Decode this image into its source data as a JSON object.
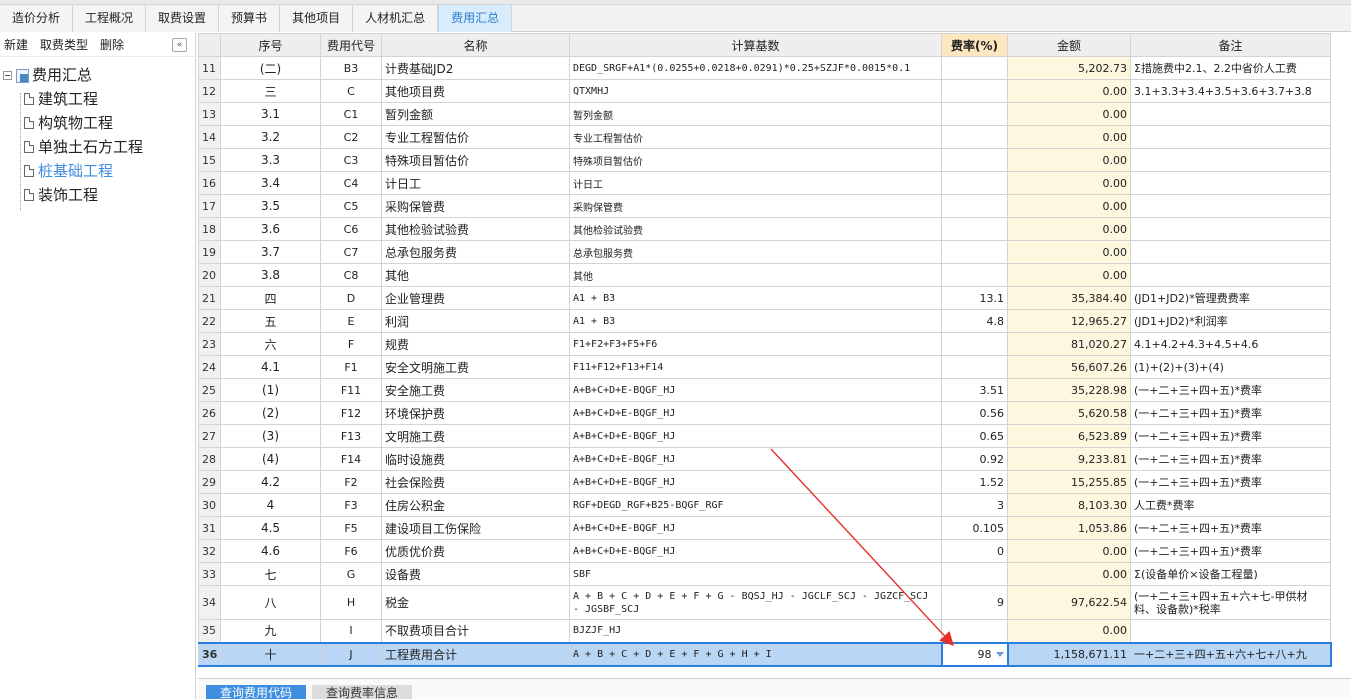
{
  "tabs": [
    "造价分析",
    "工程概况",
    "取费设置",
    "预算书",
    "其他项目",
    "人材机汇总",
    "费用汇总"
  ],
  "active_tab": "费用汇总",
  "left_toolbar": {
    "new": "新建",
    "fee_type": "取费类型",
    "delete": "删除",
    "collapse": "«"
  },
  "tree": {
    "root": "费用汇总",
    "children": [
      "建筑工程",
      "构筑物工程",
      "单独土石方工程",
      "桩基础工程",
      "装饰工程"
    ],
    "selected": "桩基础工程"
  },
  "headers": [
    "序号",
    "费用代号",
    "名称",
    "计算基数",
    "费率(%)",
    "金额",
    "备注"
  ],
  "rows": [
    {
      "n": "11",
      "seq": "(二)",
      "code": "B3",
      "name": "计费基础JD2",
      "base": "DEGD_SRGF+A1*(0.0255+0.0218+0.0291)*0.25+SZJF*0.0015*0.1",
      "rate": "",
      "amt": "5,202.73",
      "note": "Σ措施费中2.1、2.2中省价人工费"
    },
    {
      "n": "12",
      "seq": "三",
      "code": "C",
      "name": "其他项目费",
      "base": "QTXMHJ",
      "rate": "",
      "amt": "0.00",
      "note": "3.1+3.3+3.4+3.5+3.6+3.7+3.8"
    },
    {
      "n": "13",
      "seq": "3.1",
      "code": "C1",
      "name": "暂列金额",
      "base": "暂列金额",
      "rate": "",
      "amt": "0.00",
      "note": ""
    },
    {
      "n": "14",
      "seq": "3.2",
      "code": "C2",
      "name": "专业工程暂估价",
      "base": "专业工程暂估价",
      "rate": "",
      "amt": "0.00",
      "note": ""
    },
    {
      "n": "15",
      "seq": "3.3",
      "code": "C3",
      "name": "特殊项目暂估价",
      "base": "特殊项目暂估价",
      "rate": "",
      "amt": "0.00",
      "note": ""
    },
    {
      "n": "16",
      "seq": "3.4",
      "code": "C4",
      "name": "计日工",
      "base": "计日工",
      "rate": "",
      "amt": "0.00",
      "note": ""
    },
    {
      "n": "17",
      "seq": "3.5",
      "code": "C5",
      "name": "采购保管费",
      "base": "采购保管费",
      "rate": "",
      "amt": "0.00",
      "note": ""
    },
    {
      "n": "18",
      "seq": "3.6",
      "code": "C6",
      "name": "其他检验试验费",
      "base": "其他检验试验费",
      "rate": "",
      "amt": "0.00",
      "note": ""
    },
    {
      "n": "19",
      "seq": "3.7",
      "code": "C7",
      "name": "总承包服务费",
      "base": "总承包服务费",
      "rate": "",
      "amt": "0.00",
      "note": ""
    },
    {
      "n": "20",
      "seq": "3.8",
      "code": "C8",
      "name": "其他",
      "base": "其他",
      "rate": "",
      "amt": "0.00",
      "note": ""
    },
    {
      "n": "21",
      "seq": "四",
      "code": "D",
      "name": "企业管理费",
      "base": "A1 + B3",
      "rate": "13.1",
      "amt": "35,384.40",
      "note": "(JD1+JD2)*管理费费率"
    },
    {
      "n": "22",
      "seq": "五",
      "code": "E",
      "name": "利润",
      "base": "A1 + B3",
      "rate": "4.8",
      "amt": "12,965.27",
      "note": "(JD1+JD2)*利润率"
    },
    {
      "n": "23",
      "seq": "六",
      "code": "F",
      "name": "规费",
      "base": "F1+F2+F3+F5+F6",
      "rate": "",
      "amt": "81,020.27",
      "note": "4.1+4.2+4.3+4.5+4.6"
    },
    {
      "n": "24",
      "seq": "4.1",
      "code": "F1",
      "name": "安全文明施工费",
      "base": "F11+F12+F13+F14",
      "rate": "",
      "amt": "56,607.26",
      "note": "(1)+(2)+(3)+(4)"
    },
    {
      "n": "25",
      "seq": "(1)",
      "code": "F11",
      "name": "安全施工费",
      "base": "A+B+C+D+E-BQGF_HJ",
      "rate": "3.51",
      "amt": "35,228.98",
      "note": "(一+二+三+四+五)*费率"
    },
    {
      "n": "26",
      "seq": "(2)",
      "code": "F12",
      "name": "环境保护费",
      "base": "A+B+C+D+E-BQGF_HJ",
      "rate": "0.56",
      "amt": "5,620.58",
      "note": "(一+二+三+四+五)*费率"
    },
    {
      "n": "27",
      "seq": "(3)",
      "code": "F13",
      "name": "文明施工费",
      "base": "A+B+C+D+E-BQGF_HJ",
      "rate": "0.65",
      "amt": "6,523.89",
      "note": "(一+二+三+四+五)*费率"
    },
    {
      "n": "28",
      "seq": "(4)",
      "code": "F14",
      "name": "临时设施费",
      "base": "A+B+C+D+E-BQGF_HJ",
      "rate": "0.92",
      "amt": "9,233.81",
      "note": "(一+二+三+四+五)*费率"
    },
    {
      "n": "29",
      "seq": "4.2",
      "code": "F2",
      "name": "社会保险费",
      "base": "A+B+C+D+E-BQGF_HJ",
      "rate": "1.52",
      "amt": "15,255.85",
      "note": "(一+二+三+四+五)*费率"
    },
    {
      "n": "30",
      "seq": "4",
      "code": "F3",
      "name": "住房公积金",
      "base": "RGF+DEGD_RGF+B25-BQGF_RGF",
      "rate": "3",
      "amt": "8,103.30",
      "note": "人工费*费率"
    },
    {
      "n": "31",
      "seq": "4.5",
      "code": "F5",
      "name": "建设项目工伤保险",
      "base": "A+B+C+D+E-BQGF_HJ",
      "rate": "0.105",
      "amt": "1,053.86",
      "note": "(一+二+三+四+五)*费率"
    },
    {
      "n": "32",
      "seq": "4.6",
      "code": "F6",
      "name": "优质优价费",
      "base": "A+B+C+D+E-BQGF_HJ",
      "rate": "0",
      "amt": "0.00",
      "note": "(一+二+三+四+五)*费率"
    },
    {
      "n": "33",
      "seq": "七",
      "code": "G",
      "name": "设备费",
      "base": "SBF",
      "rate": "",
      "amt": "0.00",
      "note": "Σ(设备单价×设备工程量)"
    },
    {
      "n": "34",
      "seq": "八",
      "code": "H",
      "name": "税金",
      "base": "A + B + C + D + E + F + G - BQSJ_HJ - JGCLF_SCJ - JGZCF_SCJ - JGSBF_SCJ",
      "rate": "9",
      "amt": "97,622.54",
      "note": "(一+二+三+四+五+六+七-甲供材料、设备款)*税率"
    },
    {
      "n": "35",
      "seq": "九",
      "code": "I",
      "name": "不取费项目合计",
      "base": "BJZJF_HJ",
      "rate": "",
      "amt": "0.00",
      "note": ""
    },
    {
      "n": "36",
      "seq": "十",
      "code": "J",
      "name": "工程费用合计",
      "base": "A + B + C + D + E + F + G + H + I",
      "rate": "98",
      "amt": "1,158,671.11",
      "note": "一+二+三+四+五+六+七+八+九"
    }
  ],
  "bottom_buttons": {
    "query_code": "查询费用代码",
    "query_rate": "查询费率信息"
  },
  "colors": {
    "accent": "#2b7de0",
    "selected_row": "#b9d6f5",
    "amount_bg": "#fdf7df",
    "rate_header": "#fde7c1",
    "annotation_arrow": "#e8302a"
  }
}
